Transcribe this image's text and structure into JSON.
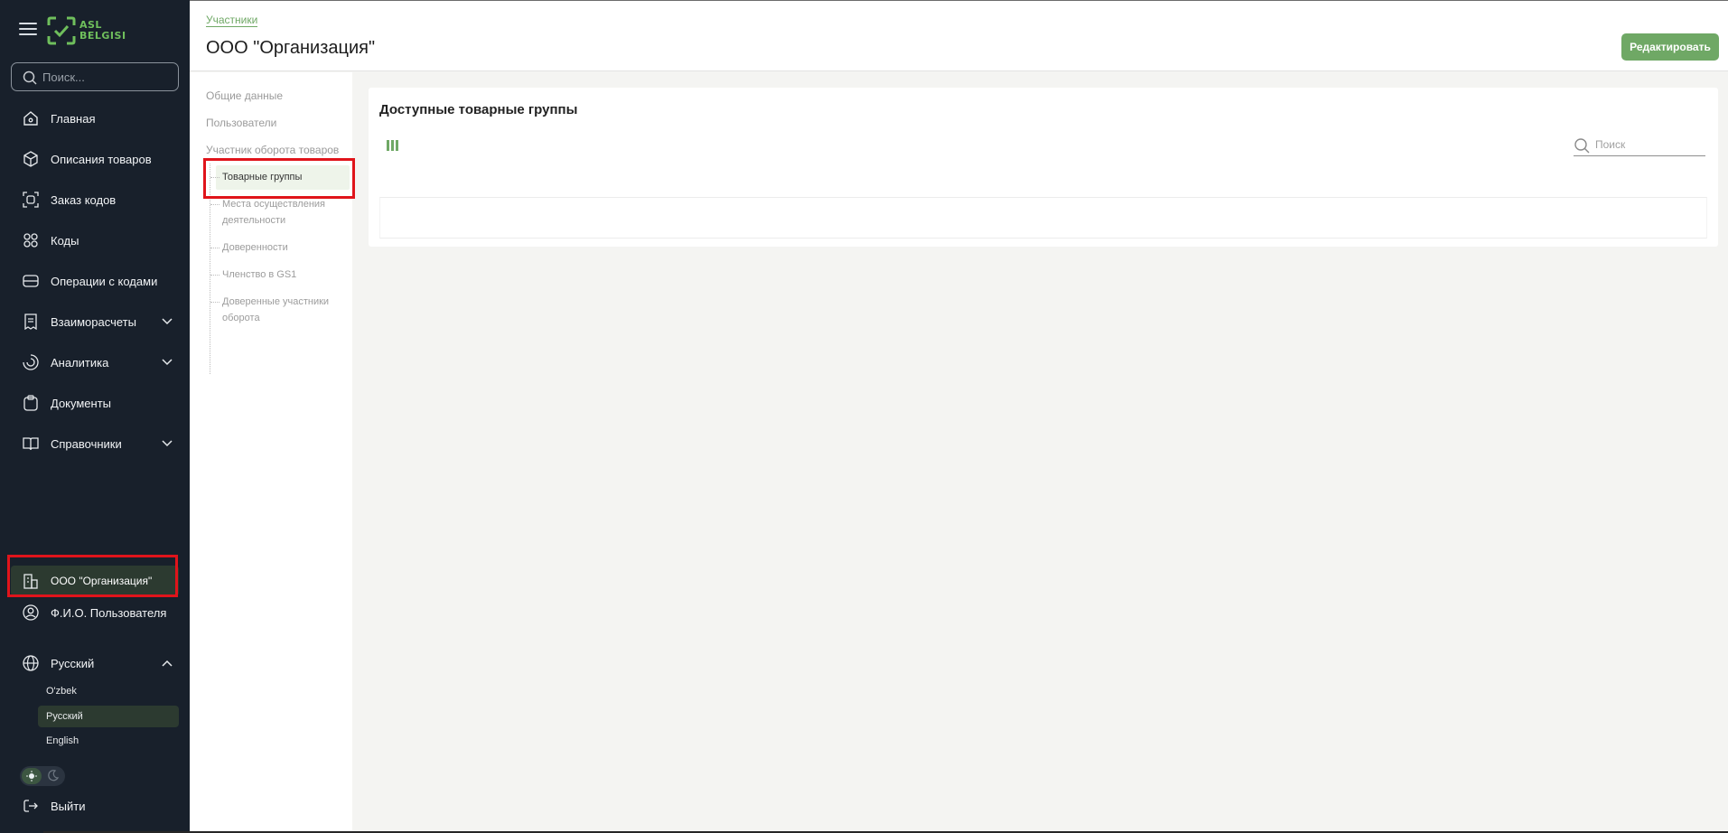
{
  "sidebar": {
    "logo_text_line1": "ASL",
    "logo_text_line2": "BELGISI",
    "search_placeholder": "Поиск...",
    "items": [
      {
        "label": "Главная"
      },
      {
        "label": "Описания товаров"
      },
      {
        "label": "Заказ кодов"
      },
      {
        "label": "Коды"
      },
      {
        "label": "Операции с кодами"
      },
      {
        "label": "Взаиморасчеты"
      },
      {
        "label": "Аналитика"
      },
      {
        "label": "Документы"
      },
      {
        "label": "Справочники"
      }
    ],
    "organization": "ООО \"Организация\"",
    "user": "Ф.И.О. Пользователя",
    "language": {
      "current": "Русский",
      "options": [
        "O'zbek",
        "Русский",
        "English"
      ]
    },
    "logout": "Выйти"
  },
  "header": {
    "breadcrumb": "Участники",
    "title": "ООО \"Организация\"",
    "edit_button": "Редактировать"
  },
  "subnav": {
    "general": "Общие данные",
    "users": "Пользователи",
    "participant": "Участник оборота товаров",
    "tree": [
      {
        "label": "Товарные группы",
        "active": true
      },
      {
        "label": "Места осуществления деятельности"
      },
      {
        "label": "Доверенности"
      },
      {
        "label": "Членство в GS1"
      },
      {
        "label": "Доверенные участники оборота"
      }
    ]
  },
  "main": {
    "card_title": "Доступные товарные группы",
    "search_placeholder": "Поиск"
  },
  "colors": {
    "sidebar_bg": "#18202b",
    "accent_green": "#6fa865",
    "highlight_red": "#e0141b"
  }
}
